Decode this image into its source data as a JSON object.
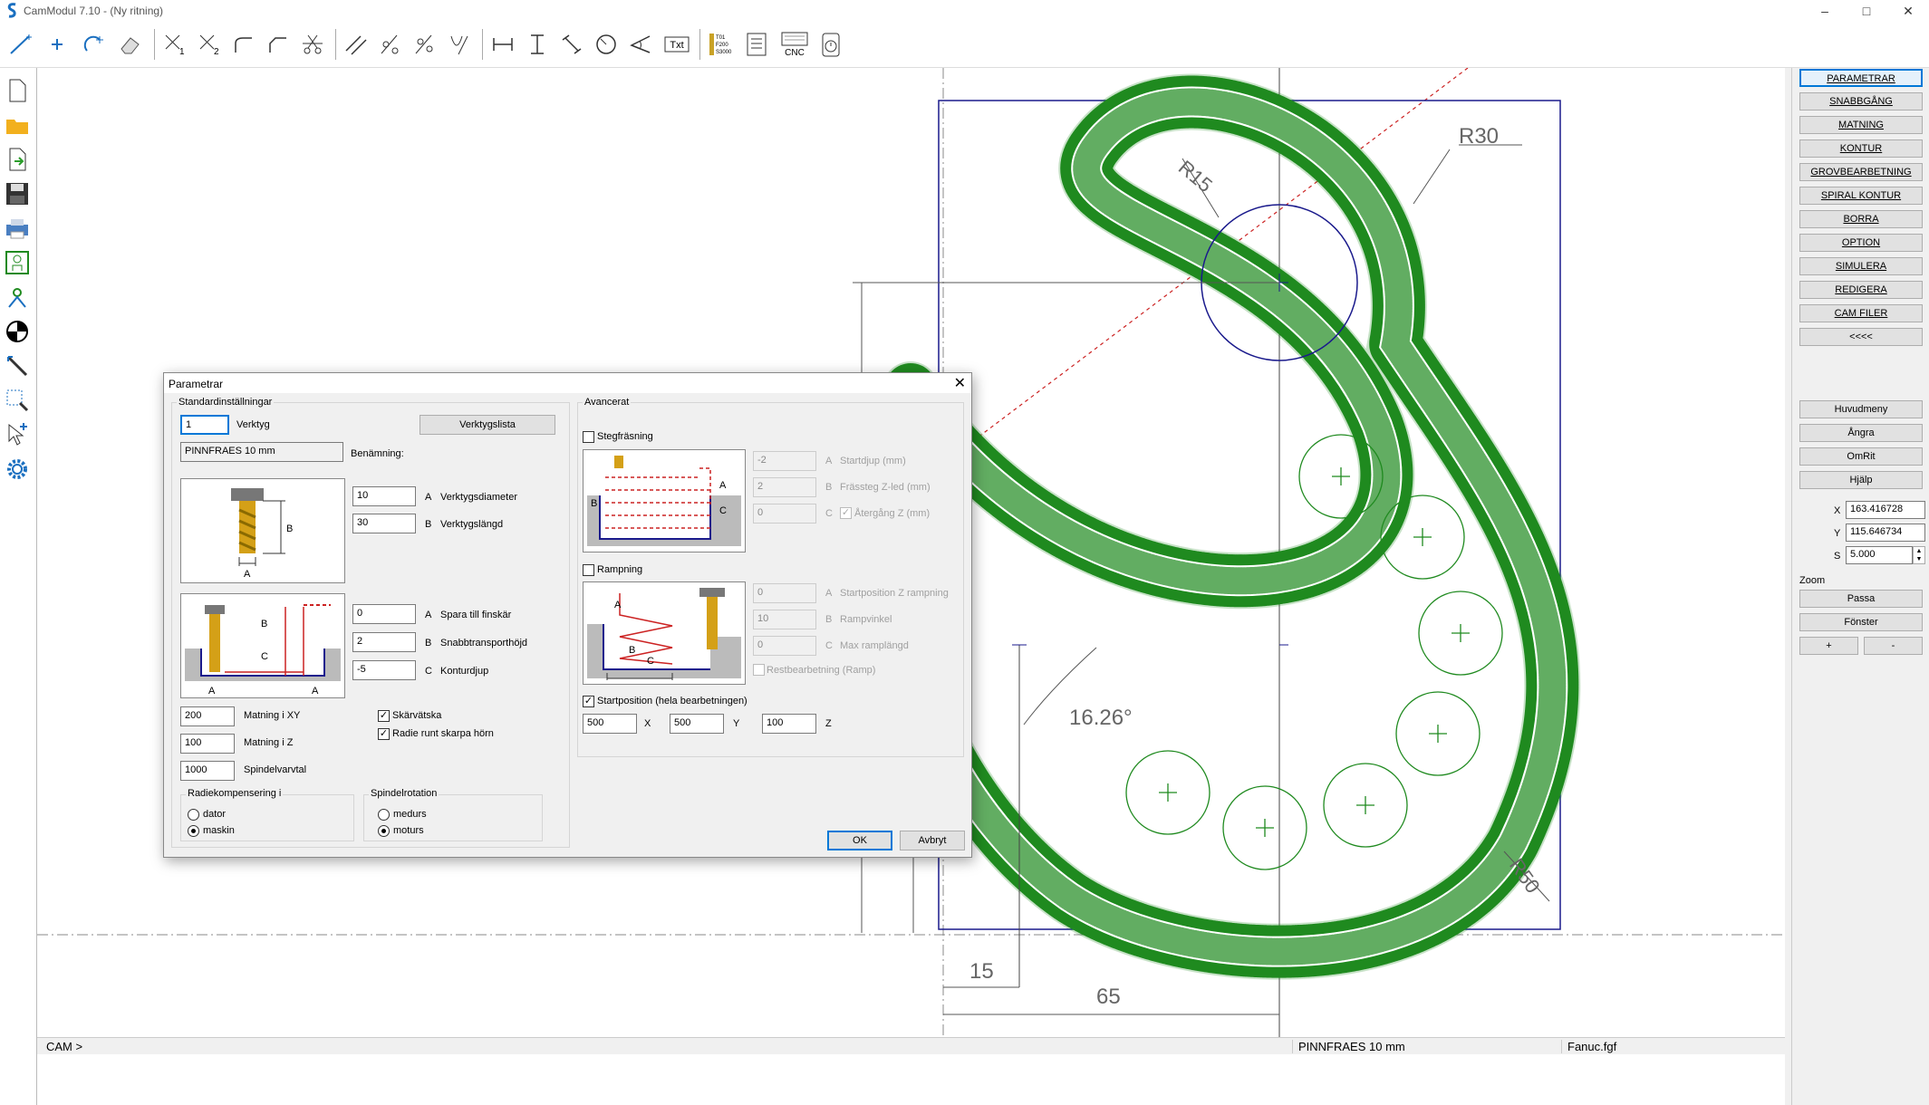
{
  "app": {
    "title": "CamModul 7.10 - (Ny ritning)"
  },
  "window_controls": {
    "minimize": "–",
    "maximize": "□",
    "close": "✕"
  },
  "toolbar": {
    "icons": [
      "line-tool-icon",
      "point-tool-icon",
      "arc-tool-icon",
      "eraser-icon",
      "trim-1-icon",
      "trim-2-icon",
      "fillet-icon",
      "chamfer-icon",
      "cut-icon",
      "parallel-icon",
      "offset-1-icon",
      "offset-2-icon",
      "offset-3-icon",
      "horizontal-dim-icon",
      "vertical-dim-icon",
      "aligned-dim-icon",
      "radius-dim-icon",
      "angle-dim-icon",
      "text-icon",
      "tool-table-icon",
      "list-icon",
      "cnc-icon",
      "timer-icon"
    ],
    "text_label": "Txt",
    "tool_table_text": "T01\nF200\nS3000",
    "cnc_label": "CNC"
  },
  "left_tools": [
    "new-file-icon",
    "open-folder-icon",
    "import-icon",
    "save-icon",
    "print-icon",
    "layer-1-icon",
    "layer-2-icon",
    "contrast-icon",
    "measure-icon",
    "zoom-window-icon",
    "select-icon",
    "settings-gear-icon"
  ],
  "right_panel": {
    "menu": [
      "PARAMETRAR",
      "SNABBGÅNG",
      "MATNING",
      "KONTUR",
      "GROVBEARBETNING",
      "SPIRAL KONTUR",
      "BORRA",
      "OPTION",
      "SIMULERA",
      "REDIGERA",
      "CAM FILER",
      "<<<<"
    ],
    "actions": [
      "Huvudmeny",
      "Ångra",
      "OmRit",
      "Hjälp"
    ],
    "x_label": "X",
    "x_value": "163.416728",
    "y_label": "Y",
    "y_value": "115.646734",
    "s_label": "S",
    "s_value": "5.000",
    "zoom_label": "Zoom",
    "zoom_buttons": [
      "Passa",
      "Fönster"
    ],
    "zoom_in": "+",
    "zoom_out": "-"
  },
  "drawing": {
    "dim_r30": "R30",
    "dim_r15": "R15",
    "dim_r50": "R50",
    "dim_angle": "16.26°",
    "dim_15": "15",
    "dim_65": "65",
    "color_toolpath": "#1f8a1f",
    "color_geometry": "#1a1a8c",
    "color_centerline": "#cc2222"
  },
  "statusbar": {
    "prompt": "CAM >",
    "tool": "PINNFRAES 10 mm",
    "post": "Fanuc.fgf"
  },
  "dialog": {
    "title": "Parametrar",
    "close": "✕",
    "std_group": "Standardinställningar",
    "tool_number": "1",
    "tool_label": "Verktyg",
    "tool_list_button": "Verktygslista",
    "tool_name": "PINNFRAES 10 mm",
    "naming_label": "Benämning:",
    "diameter_value": "10",
    "diameter_letter": "A",
    "diameter_label": "Verktygsdiameter",
    "length_value": "30",
    "length_letter": "B",
    "length_label": "Verktygslängd",
    "finish_value": "0",
    "finish_letter": "A",
    "finish_label": "Spara till finskär",
    "rapid_value": "2",
    "rapid_letter": "B",
    "rapid_label": "Snabbtransporthöjd",
    "depth_value": "-5",
    "depth_letter": "C",
    "depth_label": "Konturdjup",
    "feed_xy_value": "200",
    "feed_xy_label": "Matning i XY",
    "feed_z_value": "100",
    "feed_z_label": "Matning i Z",
    "spindle_value": "1000",
    "spindle_label": "Spindelvarvtal",
    "coolant_label": "Skärvätska",
    "coolant_checked": true,
    "radius_corner_label": "Radie runt skarpa hörn",
    "radius_corner_checked": true,
    "comp_group": "Radiekompensering i",
    "comp_options": [
      "dator",
      "maskin"
    ],
    "comp_selected": "maskin",
    "rot_group": "Spindelrotation",
    "rot_options": [
      "medurs",
      "moturs"
    ],
    "rot_selected": "moturs",
    "adv_group": "Avancerat",
    "step_label": "Stegfräsning",
    "step_checked": false,
    "step_start_value": "-2",
    "step_start_letter": "A",
    "step_start_label": "Startdjup (mm)",
    "step_z_value": "2",
    "step_z_letter": "B",
    "step_z_label": "Frässteg Z-led (mm)",
    "step_ret_value": "0",
    "step_ret_letter": "C",
    "step_ret_label": "Återgång Z (mm)",
    "ramp_label": "Rampning",
    "ramp_checked": false,
    "ramp_start_value": "0",
    "ramp_start_letter": "A",
    "ramp_start_label": "Startposition Z rampning",
    "ramp_angle_value": "10",
    "ramp_angle_letter": "B",
    "ramp_angle_label": "Rampvinkel",
    "ramp_len_value": "0",
    "ramp_len_letter": "C",
    "ramp_len_label": "Max ramplängd",
    "rest_label": "Restbearbetning (Ramp)",
    "startpos_label": "Startposition (hela bearbetningen)",
    "startpos_checked": true,
    "start_x": "500",
    "start_x_label": "X",
    "start_y": "500",
    "start_y_label": "Y",
    "start_z": "100",
    "start_z_label": "Z",
    "ok": "OK",
    "cancel": "Avbryt",
    "pic_letters": {
      "a": "A",
      "b": "B",
      "c": "C"
    }
  }
}
